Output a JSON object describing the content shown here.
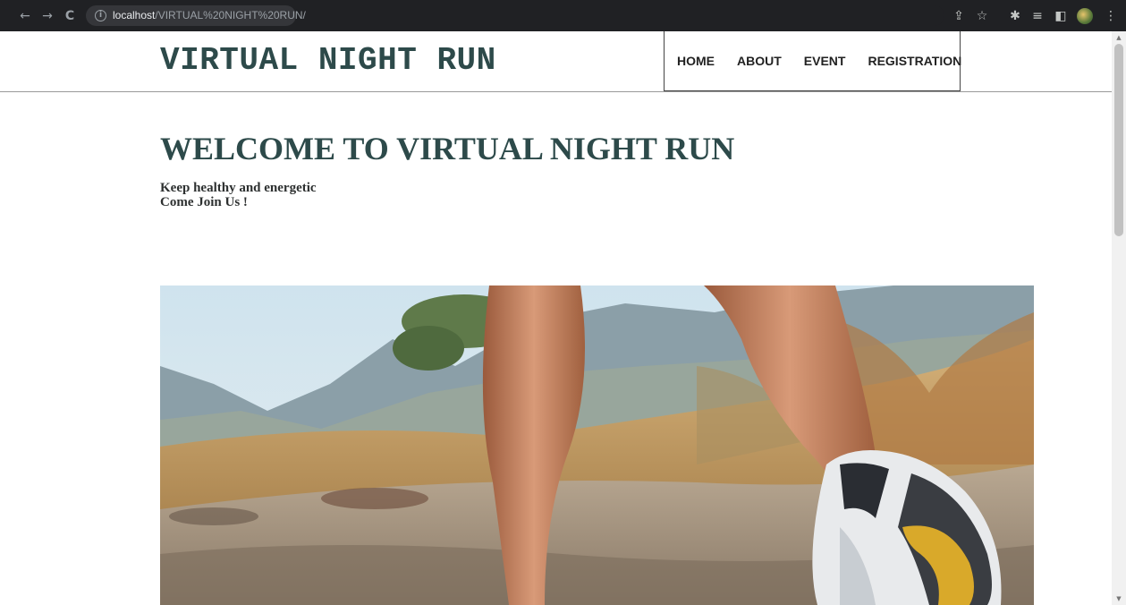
{
  "browser": {
    "url_host": "localhost",
    "url_path": "/VIRTUAL%20NIGHT%20RUN/",
    "icons": [
      "back-arrow-icon",
      "forward-arrow-icon",
      "reload-icon",
      "info-icon",
      "share-icon",
      "star-icon",
      "extensions-icon",
      "reading-list-icon",
      "side-panel-icon",
      "profile-avatar-icon",
      "more-menu-icon"
    ]
  },
  "header": {
    "title": "VIRTUAL NIGHT RUN",
    "nav": [
      {
        "label": "HOME"
      },
      {
        "label": "ABOUT"
      },
      {
        "label": "EVENT"
      },
      {
        "label": "REGISTRATION"
      }
    ]
  },
  "hero": {
    "heading": "WELCOME TO VIRTUAL NIGHT RUN",
    "line1": "Keep healthy and energetic",
    "line2": "Come Join Us !"
  },
  "colors": {
    "title": "#2d4a4a",
    "chrome": "#202124"
  }
}
